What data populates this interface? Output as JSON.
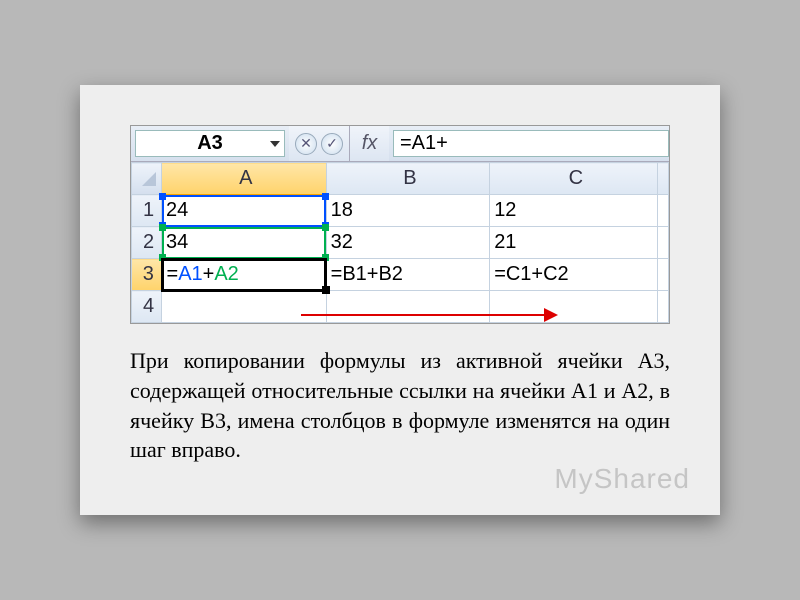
{
  "formula_bar": {
    "namebox": "A3",
    "fx_label": "fx",
    "formula_visible": "=A1+"
  },
  "columns": [
    "A",
    "B",
    "C"
  ],
  "rows": [
    "1",
    "2",
    "3",
    "4"
  ],
  "cells": {
    "a1": "24",
    "b1": "18",
    "c1": "12",
    "a2": "34",
    "b2": "32",
    "c2": "21",
    "a3_prefix": "=",
    "a3_ref1": "A1",
    "a3_plus": "+",
    "a3_ref2": "A2",
    "b3": "=B1+B2",
    "c3": "=C1+C2"
  },
  "caption": "При копировании формулы из активной ячейки A3, содержащей относительные ссылки на ячейки A1 и A2, в ячейку B3, имена столбцов в формуле изменятся на один шаг вправо.",
  "watermark": "MyShared"
}
